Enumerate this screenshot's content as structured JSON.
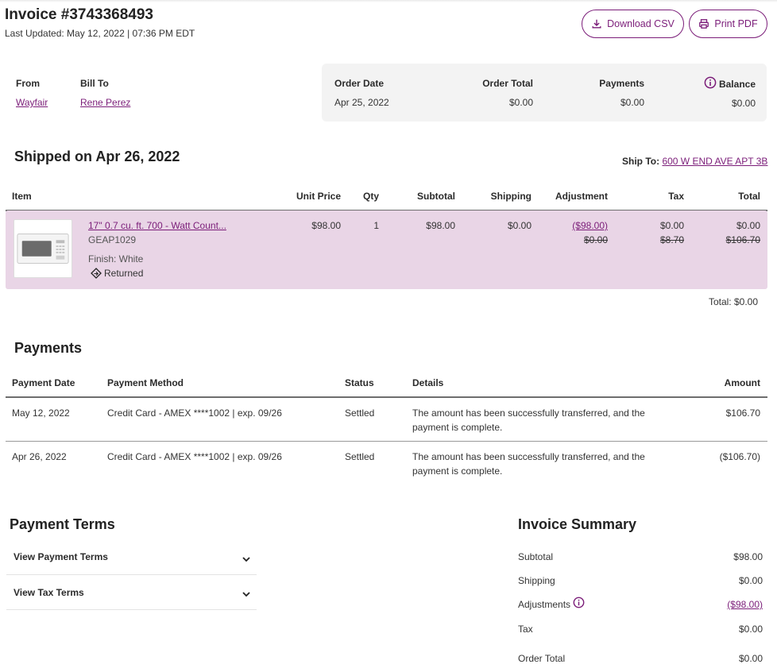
{
  "header": {
    "title": "Invoice #3743368493",
    "last_updated": "Last Updated: May 12, 2022 | 07:36 PM EDT",
    "download_csv": "Download CSV",
    "print_pdf": "Print PDF"
  },
  "parties": {
    "from_label": "From",
    "from_value": "Wayfair",
    "bill_to_label": "Bill To",
    "bill_to_value": "Rene Perez"
  },
  "order_summary": {
    "order_date_label": "Order Date",
    "order_date": "Apr 25, 2022",
    "order_total_label": "Order Total",
    "order_total": "$0.00",
    "payments_label": "Payments",
    "payments": "$0.00",
    "balance_label": "Balance",
    "balance": "$0.00"
  },
  "shipment": {
    "title": "Shipped on Apr 26, 2022",
    "ship_to_label": "Ship To:",
    "ship_to_value": "600 W END AVE APT 3B",
    "columns": [
      "Item",
      "Unit Price",
      "Qty",
      "Subtotal",
      "Shipping",
      "Adjustment",
      "Tax",
      "Total"
    ],
    "item": {
      "name": "17\" 0.7 cu. ft. 700 - Watt Count...",
      "sku": "GEAP1029",
      "finish": "Finish: White",
      "status": "Returned",
      "unit_price": "$98.00",
      "qty": "1",
      "subtotal": "$98.00",
      "shipping": "$0.00",
      "adjustment": "($98.00)",
      "adjustment_old": "$0.00",
      "tax": "$0.00",
      "tax_old": "$8.70",
      "total": "$0.00",
      "total_old": "$106.70"
    },
    "total_line": "Total: $0.00"
  },
  "payments": {
    "title": "Payments",
    "columns": [
      "Payment Date",
      "Payment Method",
      "Status",
      "Details",
      "Amount"
    ],
    "rows": [
      {
        "date": "May 12, 2022",
        "method": "Credit Card - AMEX ****1002 | exp. 09/26",
        "status": "Settled",
        "details_1": "The amount has been successfully transferred, and the",
        "details_2": "payment is complete.",
        "amount": "$106.70"
      },
      {
        "date": "Apr 26, 2022",
        "method": "Credit Card - AMEX ****1002 | exp. 09/26",
        "status": "Settled",
        "details_1": "The amount has been successfully transferred, and the",
        "details_2": "payment is complete.",
        "amount": "($106.70)"
      }
    ]
  },
  "payment_terms": {
    "title": "Payment Terms",
    "view_payment_terms": "View Payment Terms",
    "view_tax_terms": "View Tax Terms"
  },
  "invoice_summary": {
    "title": "Invoice Summary",
    "subtotal_label": "Subtotal",
    "subtotal": "$98.00",
    "shipping_label": "Shipping",
    "shipping": "$0.00",
    "adjustments_label": "Adjustments",
    "adjustments": "($98.00)",
    "tax_label": "Tax",
    "tax": "$0.00",
    "order_total_label": "Order Total",
    "order_total": "$0.00"
  },
  "colors": {
    "accent": "#7b1d79",
    "item_row_bg": "#e9d5e6",
    "summary_box_bg": "#f3f3f3"
  }
}
